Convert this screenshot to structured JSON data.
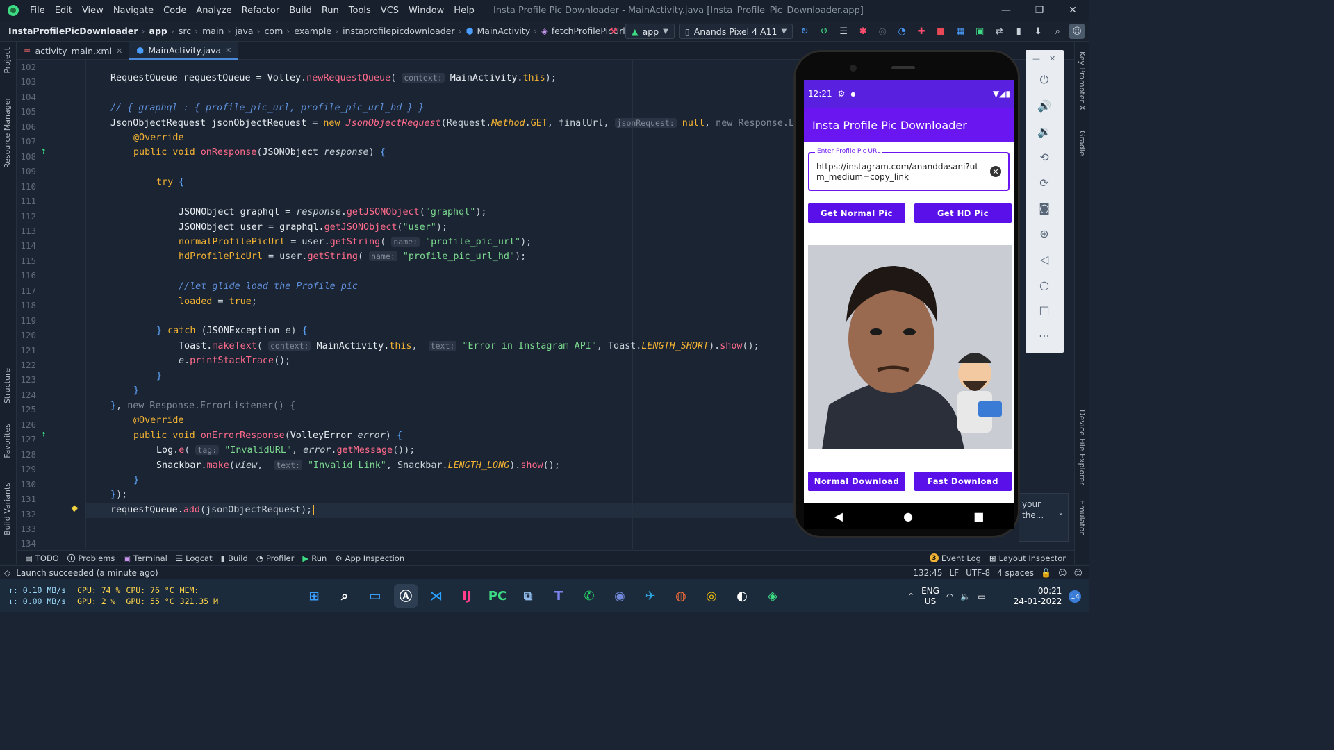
{
  "window": {
    "title": "Insta Profile Pic Downloader - MainActivity.java [Insta_Profile_Pic_Downloader.app]",
    "menu": [
      "File",
      "Edit",
      "View",
      "Navigate",
      "Code",
      "Analyze",
      "Refactor",
      "Build",
      "Run",
      "Tools",
      "VCS",
      "Window",
      "Help"
    ],
    "controls": [
      "—",
      "❐",
      "✕"
    ]
  },
  "breadcrumb": {
    "items": [
      "InstaProfilePicDownloader",
      "app",
      "src",
      "main",
      "java",
      "com",
      "example",
      "instaprofilepicdownloader",
      "MainActivity",
      "fetchProfilePicUrls"
    ]
  },
  "toolbar": {
    "run_config": "app",
    "device": "Anands Pixel 4 A11"
  },
  "tabs": [
    {
      "label": "activity_main.xml",
      "active": false
    },
    {
      "label": "MainActivity.java",
      "active": true
    }
  ],
  "left_strip": [
    "Project",
    "Resource Manager",
    "Structure",
    "Favorites",
    "Build Variants"
  ],
  "right_strip": [
    "Key Promoter X",
    "Gradle",
    "Device File Explorer",
    "Emulator"
  ],
  "line_numbers": [
    "102",
    "103",
    "104",
    "105",
    "106",
    "107",
    "108",
    "109",
    "110",
    "111",
    "112",
    "113",
    "114",
    "115",
    "116",
    "117",
    "118",
    "119",
    "120",
    "121",
    "122",
    "123",
    "124",
    "125",
    "126",
    "127",
    "128",
    "129",
    "130",
    "131",
    "132",
    "133",
    "134"
  ],
  "bottom_tabs": [
    "TODO",
    "Problems",
    "Terminal",
    "Logcat",
    "Build",
    "Profiler",
    "Run",
    "App Inspection"
  ],
  "bottom_right_tabs": [
    "Event Log",
    "Layout Inspector"
  ],
  "event_count": "3",
  "status": {
    "message": "Launch succeeded (a minute ago)",
    "position": "132:45",
    "line_sep": "LF",
    "encoding": "UTF-8",
    "indent": "4 spaces"
  },
  "popup": {
    "text1": "your",
    "text2": "the..."
  },
  "phone": {
    "time": "12:21",
    "app_title": "Insta Profile Pic Downloader",
    "field_label": "Enter Profile Pic URL",
    "field_value": "https://instagram.com/ananddasani?utm_medium=copy_link",
    "btn_normal_pic": "Get Normal Pic",
    "btn_hd_pic": "Get HD Pic",
    "btn_normal_download": "Normal Download",
    "btn_fast_download": "Fast Download"
  },
  "taskbar": {
    "net_up": "↑: 0.10 MB/s",
    "net_down": "↓: 0.00 MB/s",
    "cpu": "CPU: 74 %",
    "cpu_temp": "CPU: 76 °C",
    "mem": "MEM:",
    "gpu": "GPU: 2 %",
    "gpu_temp": "GPU: 55 °C",
    "mem_val": "321.35 M",
    "lang1": "ENG",
    "lang2": "US",
    "time": "00:21",
    "date": "24-01-2022",
    "notif": "14"
  },
  "colors": {
    "accent": "#6a16f0",
    "editor_bg": "#1b2433",
    "keyword": "#f2b233",
    "method": "#ff6b8b",
    "string": "#7bd88f"
  }
}
